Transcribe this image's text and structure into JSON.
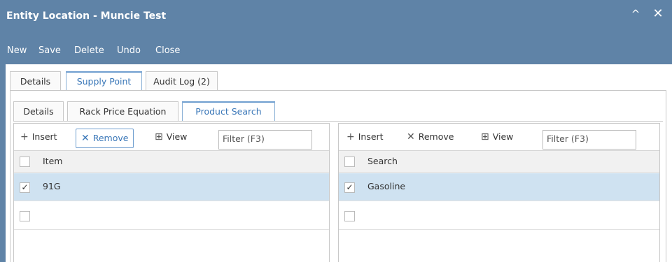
{
  "window": {
    "title": "Entity Location - Muncie Test",
    "collapse_glyph": "^",
    "close_glyph": "✕"
  },
  "toolbar": {
    "new": "New",
    "save": "Save",
    "delete": "Delete",
    "undo": "Undo",
    "close": "Close"
  },
  "tabs": [
    {
      "label": "Details"
    },
    {
      "label": "Supply Point"
    },
    {
      "label": "Audit Log (2)"
    }
  ],
  "subtabs": [
    {
      "label": "Details"
    },
    {
      "label": "Rack Price Equation"
    },
    {
      "label": "Product Search"
    }
  ],
  "left_grid": {
    "insert": "Insert",
    "remove": "Remove",
    "view": "View",
    "filter_placeholder": "Filter (F3)",
    "column": "Item",
    "rows": [
      {
        "value": "91G",
        "checked": "✓"
      }
    ]
  },
  "right_grid": {
    "insert": "Insert",
    "remove": "Remove",
    "view": "View",
    "filter_placeholder": "Filter (F3)",
    "column": "Search",
    "rows": [
      {
        "value": "Gasoline",
        "checked": "✓"
      }
    ]
  },
  "icons": {
    "insert": "+",
    "remove": "✕",
    "view": "⊞"
  },
  "colors": {
    "titlebar": "#5f83a7",
    "accent": "#3a77b8",
    "selected_row": "#cfe2f1"
  }
}
